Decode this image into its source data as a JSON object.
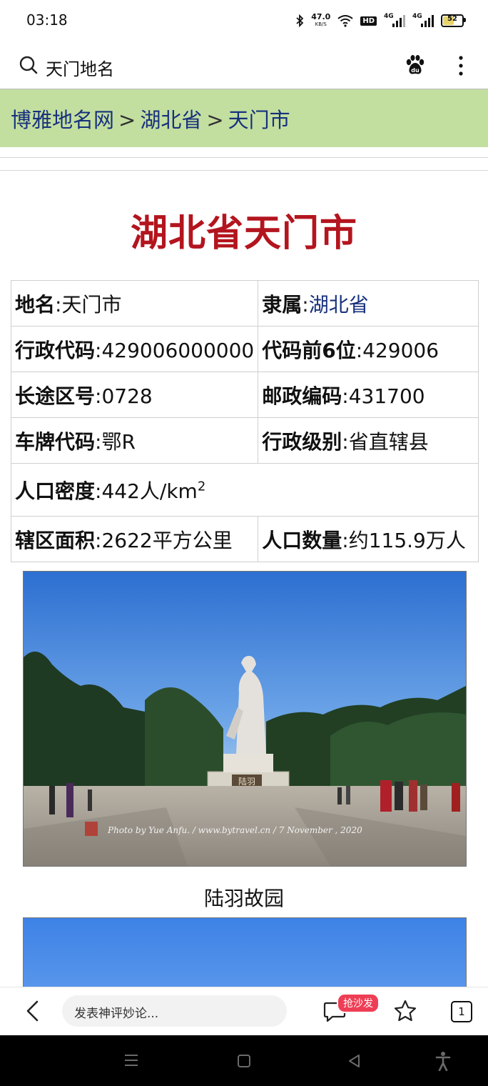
{
  "status_bar": {
    "time": "03:18",
    "net_speed": "47.0",
    "net_speed_unit": "KB/S",
    "hd_label": "HD",
    "signal_1_label": "4G",
    "signal_2_label": "4G",
    "battery": "52"
  },
  "search": {
    "query": "天门地名"
  },
  "breadcrumb": {
    "site": "博雅地名网",
    "sep": ">",
    "province": "湖北省",
    "city": "天门市"
  },
  "page": {
    "title": "湖北省天门市"
  },
  "info": {
    "name_label": "地名",
    "name_value": "天门市",
    "belongs_label": "隶属",
    "belongs_value": "湖北省",
    "admin_code_label": "行政代码",
    "admin_code_value": "429006000000",
    "code6_label": "代码前6位",
    "code6_value": "429006",
    "area_code_label": "长途区号",
    "area_code_value": "0728",
    "postal_label": "邮政编码",
    "postal_value": "431700",
    "plate_label": "车牌代码",
    "plate_value": "鄂R",
    "level_label": "行政级别",
    "level_value": "省直辖县",
    "density_label": "人口密度",
    "density_value": "442人/km",
    "density_exp": "2",
    "area_label": "辖区面积",
    "area_value": "2622平方公里",
    "population_label": "人口数量",
    "population_value": "约115.9万人"
  },
  "photos": {
    "caption_1": "陆羽故园",
    "plaque_text": "陆羽",
    "watermark": "Photo by Yue Anfu.   /   www.bytravel.cn   /   7 November , 2020"
  },
  "toolbar": {
    "comment_placeholder": "发表神评妙论...",
    "sofa_badge": "抢沙发",
    "tab_count": "1"
  }
}
